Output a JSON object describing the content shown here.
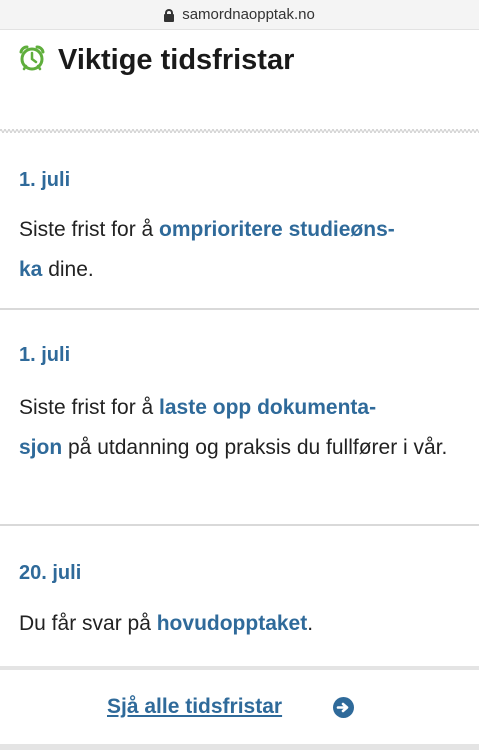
{
  "browser": {
    "url": "samordnaopptak.no"
  },
  "header": {
    "title": "Viktige tidsfristar",
    "icon": "alarm-clock-icon",
    "icon_color": "#5fae3c"
  },
  "deadlines": [
    {
      "date": "1. juli",
      "text_before": "Siste frist for å ",
      "link_line1": "omprioritere studieøns-",
      "link_line2": "ka",
      "text_after": " dine."
    },
    {
      "date": "1. juli",
      "text_before": "Siste frist for å ",
      "link_line1": "laste opp dokumenta-",
      "link_line2": "sjon",
      "text_after": " på utdanning og praksis du fullfører i vår."
    },
    {
      "date": "20. juli",
      "text_before": "Du får svar på ",
      "link": "hovudopptaket",
      "text_after": "."
    }
  ],
  "footer": {
    "see_all_label": "Sjå alle tidsfristar",
    "arrow_icon": "arrow-right-circle-icon"
  },
  "colors": {
    "link": "#2f6a9a",
    "text": "#222222",
    "divider": "#d9d9d9"
  }
}
